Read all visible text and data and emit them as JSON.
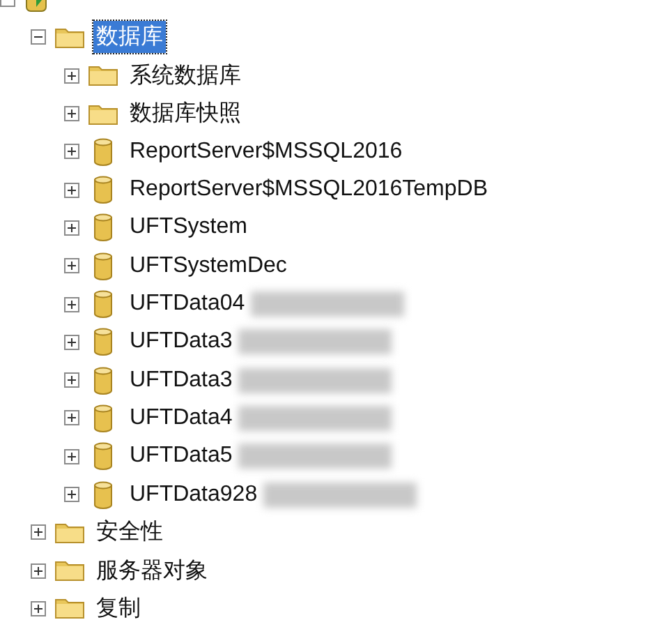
{
  "tree": [
    {
      "kind": "server",
      "expanded": true,
      "children": [
        {
          "label": "数据库",
          "kind": "folder",
          "expanded": true,
          "selected": true,
          "children": [
            {
              "label": "系统数据库",
              "kind": "folder",
              "expanded": false,
              "selected": false,
              "redacted": false
            },
            {
              "label": "数据库快照",
              "kind": "folder",
              "expanded": false,
              "selected": false,
              "redacted": false
            },
            {
              "label": "ReportServer$MSSQL2016",
              "kind": "database",
              "expanded": false,
              "selected": false,
              "redacted": false
            },
            {
              "label": "ReportServer$MSSQL2016TempDB",
              "kind": "database",
              "expanded": false,
              "selected": false,
              "redacted": false
            },
            {
              "label": "UFTSystem",
              "kind": "database",
              "expanded": false,
              "selected": false,
              "redacted": false
            },
            {
              "label": "UFTSystemDec",
              "kind": "database",
              "expanded": false,
              "selected": false,
              "redacted": false
            },
            {
              "label": "UFTData04",
              "kind": "database",
              "expanded": false,
              "selected": false,
              "redacted": true
            },
            {
              "label": "UFTData3",
              "kind": "database",
              "expanded": false,
              "selected": false,
              "redacted": true
            },
            {
              "label": "UFTData3",
              "kind": "database",
              "expanded": false,
              "selected": false,
              "redacted": true
            },
            {
              "label": "UFTData4",
              "kind": "database",
              "expanded": false,
              "selected": false,
              "redacted": true
            },
            {
              "label": "UFTData5",
              "kind": "database",
              "expanded": false,
              "selected": false,
              "redacted": true
            },
            {
              "label": "UFTData928",
              "kind": "database",
              "expanded": false,
              "selected": false,
              "redacted": true
            }
          ]
        },
        {
          "label": "安全性",
          "kind": "folder",
          "expanded": false,
          "selected": false
        },
        {
          "label": "服务器对象",
          "kind": "folder",
          "expanded": false,
          "selected": false
        },
        {
          "label": "复制",
          "kind": "folder",
          "expanded": false,
          "selected": false
        }
      ]
    }
  ]
}
